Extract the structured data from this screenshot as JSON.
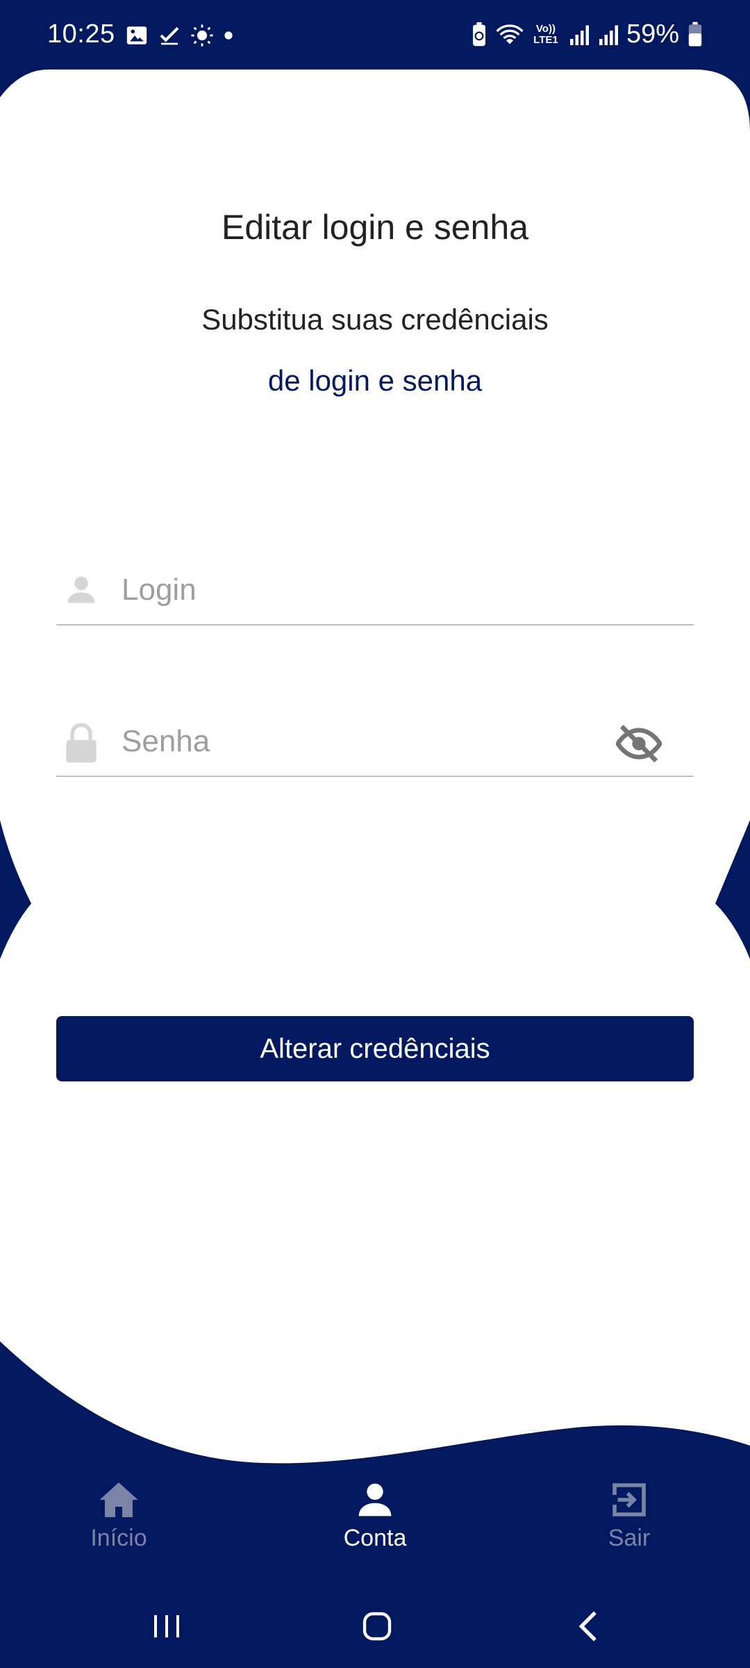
{
  "status_bar": {
    "time": "10:25",
    "battery_percent": "59%",
    "volte_label": "Vo)) LTE1",
    "left_icons": [
      "image-icon",
      "check-icon",
      "brightness-icon",
      "dot-icon"
    ],
    "right_icons": [
      "battery-saver-icon",
      "wifi-icon",
      "volte-icon",
      "signal-icon",
      "signal-icon",
      "battery-icon"
    ]
  },
  "header": {
    "title": "Editar login e senha",
    "subtitle_line1": "Substitua suas credênciais",
    "subtitle_line2": "de login e senha"
  },
  "form": {
    "login_placeholder": "Login",
    "password_placeholder": "Senha",
    "login_icon": "person-icon",
    "password_icon": "lock-icon",
    "visibility_icon": "eye-off-icon",
    "submit_label": "Alterar credênciais"
  },
  "bottom_nav": {
    "items": [
      {
        "label": "Início",
        "icon": "home-icon",
        "active": false
      },
      {
        "label": "Conta",
        "icon": "person-icon",
        "active": true
      },
      {
        "label": "Sair",
        "icon": "exit-icon",
        "active": false
      }
    ]
  },
  "system_nav": {
    "icons": [
      "recents-icon",
      "home-icon",
      "back-icon"
    ]
  },
  "colors": {
    "primary": "#03195f",
    "background": "#ffffff",
    "inactive_nav": "#7b84a6",
    "placeholder": "#9e9e9e"
  }
}
